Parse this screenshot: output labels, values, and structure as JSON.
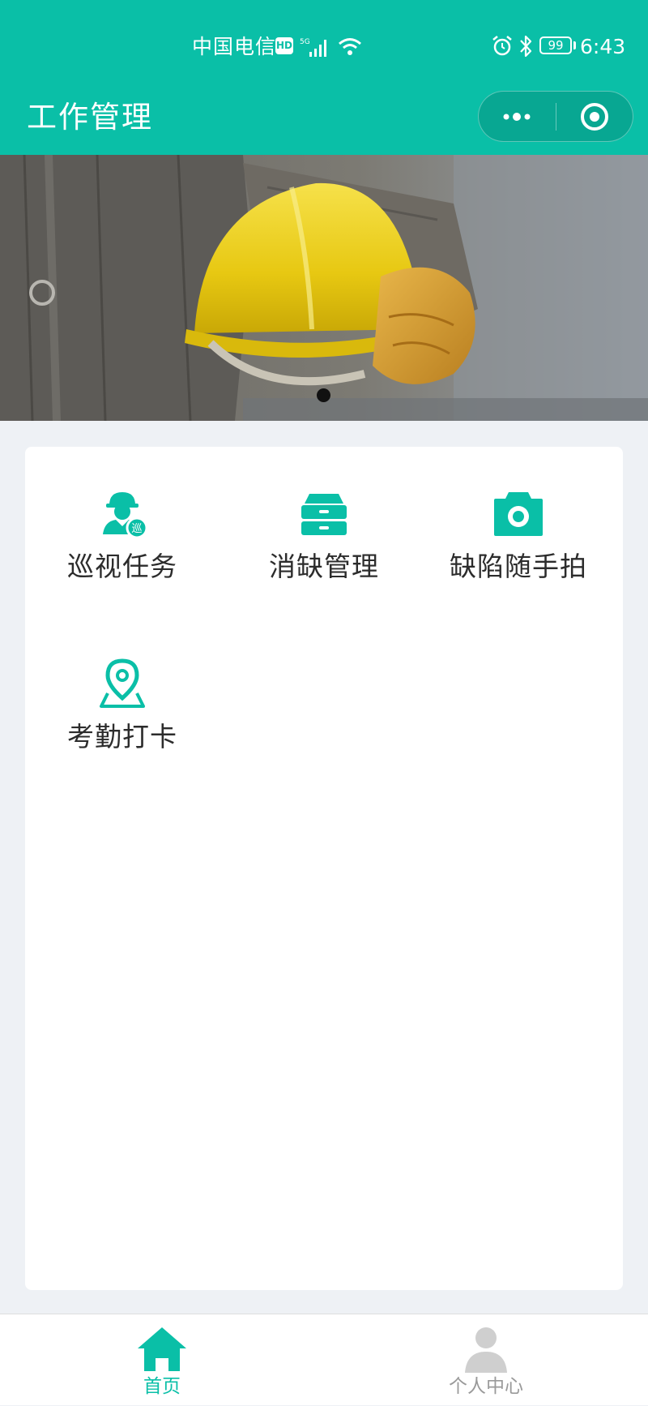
{
  "status_bar": {
    "carrier": "中国电信",
    "hd_badge": "HD",
    "battery": "99",
    "time": "6:43"
  },
  "nav": {
    "title": "工作管理"
  },
  "banner": {
    "slide_count": 1,
    "active_slide": 1
  },
  "menu": {
    "items": [
      {
        "label": "巡视任务",
        "icon": "inspection-worker-icon"
      },
      {
        "label": "消缺管理",
        "icon": "drawer-cabinet-icon"
      },
      {
        "label": "缺陷随手拍",
        "icon": "camera-icon"
      },
      {
        "label": "考勤打卡",
        "icon": "location-pin-icon"
      }
    ]
  },
  "tabbar": {
    "tabs": [
      {
        "label": "首页",
        "icon": "home-icon",
        "active": true
      },
      {
        "label": "个人中心",
        "icon": "person-icon",
        "active": false
      }
    ]
  },
  "colors": {
    "accent": "#0abfa7",
    "page_background": "#eef1f5",
    "inactive_tab": "#9a9a9a"
  }
}
